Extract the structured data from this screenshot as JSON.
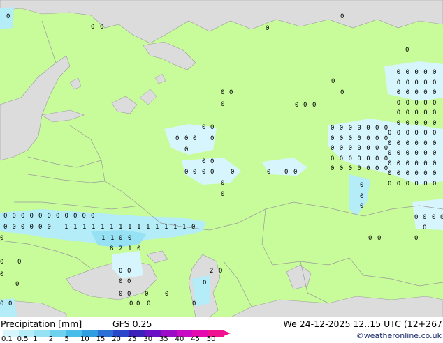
{
  "legend": {
    "title": "Precipitation [mm]",
    "model": "GFS 0.25",
    "datetime": "We 24-12-2025 12..15 UTC (12+267",
    "credit": "©weatheronline.co.uk",
    "scale": [
      {
        "label": "0.1",
        "color": "#d7f5fc"
      },
      {
        "label": "0.5",
        "color": "#b4ecf8"
      },
      {
        "label": "1",
        "color": "#96e2f4"
      },
      {
        "label": "2",
        "color": "#6ed2ef"
      },
      {
        "label": "5",
        "color": "#49bde9"
      },
      {
        "label": "10",
        "color": "#2f9ee0"
      },
      {
        "label": "15",
        "color": "#2a6fd6"
      },
      {
        "label": "20",
        "color": "#2b47c9"
      },
      {
        "label": "25",
        "color": "#3a1fb8"
      },
      {
        "label": "30",
        "color": "#6a10c6"
      },
      {
        "label": "35",
        "color": "#9c0cc8"
      },
      {
        "label": "40",
        "color": "#c80ac4"
      },
      {
        "label": "45",
        "color": "#e40ab0"
      },
      {
        "label": "50",
        "color": "#f01290"
      }
    ]
  },
  "map": {
    "colors": {
      "land": "#c8fc9b",
      "sea": "#dcdcdc",
      "border": "#9a9a9a"
    },
    "labels_ones": [
      "1",
      "1",
      "1",
      "1",
      "1",
      "1",
      "1",
      "1",
      "1",
      "1",
      "1",
      "1",
      "1",
      "1",
      "1",
      "1"
    ],
    "labels_zeros": [
      "0",
      "0",
      "0"
    ],
    "labels_misc": [
      "8",
      "2",
      "1",
      "0",
      "2",
      "0"
    ]
  }
}
